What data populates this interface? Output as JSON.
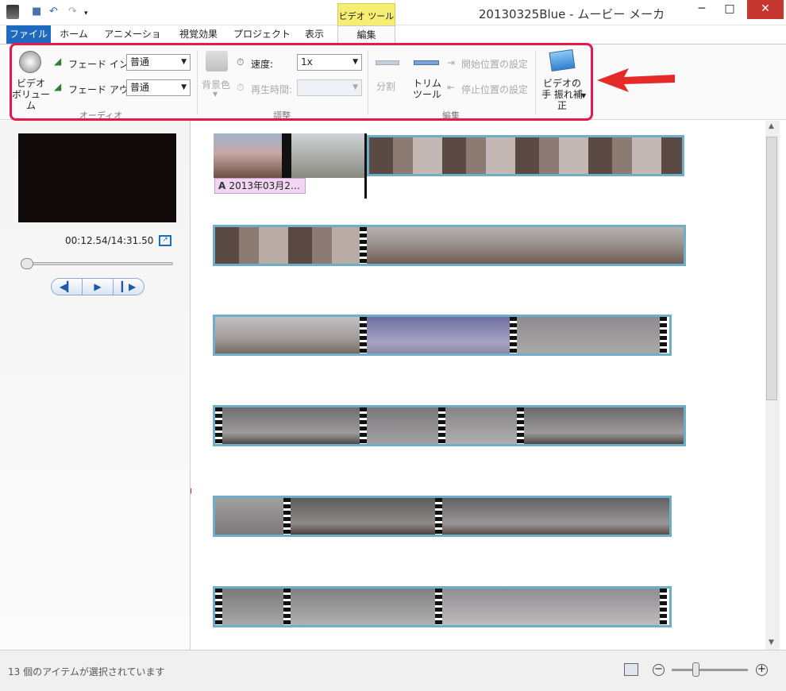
{
  "titlebar": {
    "title": "20130325Blue - ムービー メーカー",
    "context_tab": "ビデオ ツール",
    "min": "─",
    "max": "□",
    "close": "✕"
  },
  "tabs": [
    {
      "label": "ファイル"
    },
    {
      "label": "ホーム"
    },
    {
      "label": "アニメーション"
    },
    {
      "label": "視覚効果"
    },
    {
      "label": "プロジェクト"
    },
    {
      "label": "表示"
    },
    {
      "label": "編集"
    }
  ],
  "ribbon": {
    "video_volume": "ビデオ ボリューム",
    "fade_in_label": "フェード イン:",
    "fade_in_value": "普通",
    "fade_out_label": "フェード アウト:",
    "fade_out_value": "普通",
    "audio_group": "オーディオ",
    "bg_color": "背景色",
    "speed_label": "速度:",
    "speed_value": "1x",
    "duration_label": "再生時間:",
    "adjust_group": "調整",
    "split": "分割",
    "trim_tool": "トリム ツール",
    "set_start": "開始位置の設定",
    "set_end": "停止位置の設定",
    "edit_group": "編集",
    "stabilize": "ビデオの手 振れ補正"
  },
  "preview": {
    "time": "00:12.54/14:31.50"
  },
  "caption": {
    "text": "2013年03月2…"
  },
  "status": {
    "text": "13 個のアイテムが選択されています"
  },
  "colors": {
    "accent": "#1f6ac1",
    "highlight": "#e5194b",
    "strip_border": "#6faec9",
    "context_tab": "#f6ee72"
  }
}
